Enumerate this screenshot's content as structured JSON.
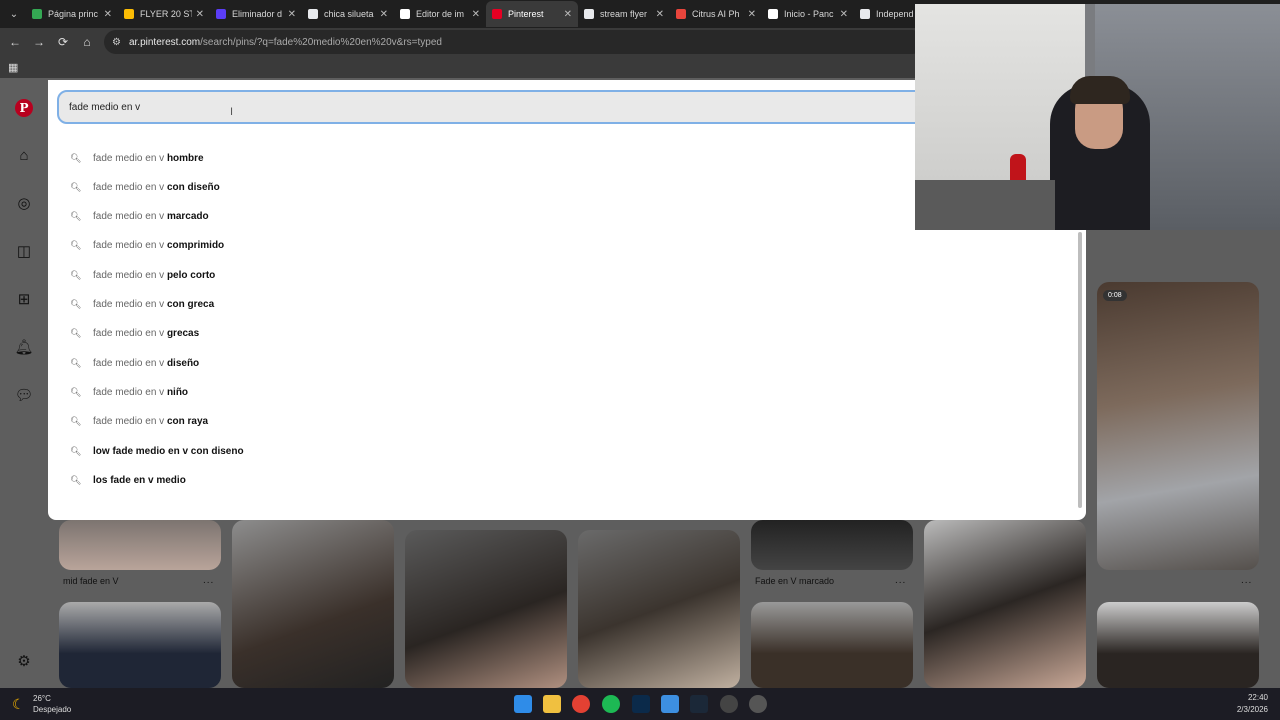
{
  "browser": {
    "tabs": [
      {
        "title": "Página princ",
        "color": "#34a853"
      },
      {
        "title": "FLYER 20 ST",
        "color": "#fbbc04"
      },
      {
        "title": "Eliminador d",
        "color": "#5b3df5"
      },
      {
        "title": "chica silueta",
        "color": "#e8eaed"
      },
      {
        "title": "Editor de im",
        "color": "#ffffff"
      },
      {
        "title": "Pinterest",
        "color": "#e60023",
        "active": true
      },
      {
        "title": "stream flyer",
        "color": "#e8eaed"
      },
      {
        "title": "Citrus AI Ph",
        "color": "#e8453c"
      },
      {
        "title": "Inicio - Panc",
        "color": "#ffffff"
      },
      {
        "title": "Independ",
        "color": "#e8eaed"
      }
    ],
    "url_host": "ar.pinterest.com",
    "url_path": "/search/pins/?q=fade%20medio%20en%20v&rs=typed"
  },
  "search": {
    "value": "fade medio en v",
    "suggestions": [
      {
        "prefix": "fade medio en v ",
        "bold": "hombre"
      },
      {
        "prefix": "fade medio en v ",
        "bold": "con diseño"
      },
      {
        "prefix": "fade medio en v ",
        "bold": "marcado"
      },
      {
        "prefix": "fade medio en v ",
        "bold": "comprimido"
      },
      {
        "prefix": "fade medio en v ",
        "bold": "pelo corto"
      },
      {
        "prefix": "fade medio en v ",
        "bold": "con greca"
      },
      {
        "prefix": "fade medio en v ",
        "bold": "grecas"
      },
      {
        "prefix": "fade medio en v ",
        "bold": "diseño"
      },
      {
        "prefix": "fade medio en v ",
        "bold": "niño"
      },
      {
        "prefix": "fade medio en v ",
        "bold": "con raya"
      },
      {
        "prefix": "",
        "bold": "low fade medio en v con diseno"
      },
      {
        "prefix": "",
        "bold": "los fade en v medio"
      }
    ]
  },
  "pins": {
    "captions": [
      "mid fade en V",
      "Fade en V marcado"
    ],
    "video_duration": "0:08",
    "more": "..."
  },
  "taskbar": {
    "temperature": "26°C",
    "weather": "Despejado",
    "time": "22:40",
    "date": "2/3/2026"
  }
}
